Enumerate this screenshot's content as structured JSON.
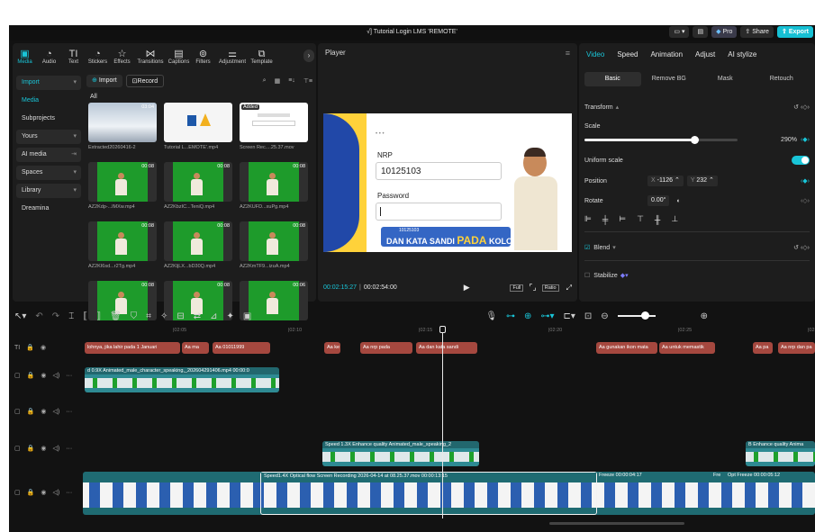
{
  "window": {
    "title": "√] Tutorial Login LMS 'REMOTE'",
    "pro_label": "Pro",
    "share_label": "Share",
    "export_label": "Export"
  },
  "media_toolbar": [
    {
      "label": "Media",
      "icon": "media-icon"
    },
    {
      "label": "Audio",
      "icon": "audio-icon"
    },
    {
      "label": "Text",
      "icon": "text-icon"
    },
    {
      "label": "Stickers",
      "icon": "sticker-icon"
    },
    {
      "label": "Effects",
      "icon": "effects-icon"
    },
    {
      "label": "Transitions",
      "icon": "transition-icon"
    },
    {
      "label": "Captions",
      "icon": "captions-icon"
    },
    {
      "label": "Filters",
      "icon": "filters-icon"
    },
    {
      "label": "Adjustment",
      "icon": "adjustment-icon"
    },
    {
      "label": "Template",
      "icon": "template-icon"
    }
  ],
  "sidebar": {
    "items": [
      {
        "label": "Import",
        "style": "dd-hl"
      },
      {
        "label": "Media",
        "style": "hl"
      },
      {
        "label": "Subprojects",
        "style": ""
      },
      {
        "label": "Yours",
        "style": "dd"
      },
      {
        "label": "AI media",
        "style": "dd"
      },
      {
        "label": "Spaces",
        "style": "dd"
      },
      {
        "label": "Library",
        "style": "dd"
      },
      {
        "label": "Dreamina",
        "style": ""
      }
    ]
  },
  "media": {
    "import_label": "Import",
    "record_label": "Record",
    "all_label": "All",
    "items": [
      {
        "caption": "Extracted20260416-2",
        "duration": "03:04",
        "kind": "screen",
        "added": false
      },
      {
        "caption": "Tutorial L...EMOTE'.mp4",
        "duration": "",
        "kind": "logo",
        "added": false
      },
      {
        "caption": "Screen Rec....25.37.mov",
        "duration": "",
        "kind": "screen2",
        "added": true
      },
      {
        "caption": "AZ2Kdp-...lMXw.mp4",
        "duration": "00:08",
        "kind": "green",
        "added": false
      },
      {
        "caption": "AZ2KbzIC...TeniQ.mp4",
        "duration": "00:08",
        "kind": "green",
        "added": false
      },
      {
        "caption": "AZ2KUFD...xuPg.mp4",
        "duration": "00:08",
        "kind": "green",
        "added": false
      },
      {
        "caption": "AZ2KI6sd...r2Tg.mp4",
        "duration": "00:08",
        "kind": "green",
        "added": false
      },
      {
        "caption": "AZ2KljLX...bD30Q.mp4",
        "duration": "00:08",
        "kind": "green",
        "added": false
      },
      {
        "caption": "AZ2KmTF9...izuA.mp4",
        "duration": "00:08",
        "kind": "green",
        "added": false
      },
      {
        "caption": "",
        "duration": "00:08",
        "kind": "green",
        "added": false
      },
      {
        "caption": "",
        "duration": "00:08",
        "kind": "green",
        "added": false
      },
      {
        "caption": "",
        "duration": "00:06",
        "kind": "green",
        "added": false
      }
    ],
    "added_label": "Added"
  },
  "player": {
    "title": "Player",
    "current_time": "00:02:15:27",
    "total_time": "00:02:54:00",
    "full_label": "Full",
    "ratio_label": "Ratio",
    "screen": {
      "nrp_label": "NRP",
      "nrp_value": "10125103",
      "password_label": "Password",
      "caption_small": "10125103",
      "caption_main": "DAN KATA SANDI",
      "caption_highlight": "PADA",
      "caption_end": "KOLOM"
    }
  },
  "inspector": {
    "tabs": [
      "Video",
      "Speed",
      "Animation",
      "Adjust",
      "AI stylize"
    ],
    "subtabs": [
      "Basic",
      "Remove BG",
      "Mask",
      "Retouch"
    ],
    "transform_label": "Transform",
    "scale_label": "Scale",
    "scale_value": "290%",
    "scale_level": 0.72,
    "uniform_scale_label": "Uniform scale",
    "position_label": "Position",
    "pos_x_label": "X",
    "pos_x": "-1126",
    "pos_y_label": "Y",
    "pos_y": "232",
    "rotate_label": "Rotate",
    "rotate_value": "0.00°",
    "blend_label": "Blend",
    "stabilize_label": "Stabilize"
  },
  "timeline": {
    "ruler": [
      "|02:05",
      "|02:10",
      "|02:15",
      "|02:20",
      "|02:25",
      "|02:30"
    ],
    "text_clips": [
      {
        "label": "lohnya, jika lahir pada 1 Januari"
      },
      {
        "label": "Aa ma"
      },
      {
        "label": "Aa 01011999"
      },
      {
        "label": "Aa ke"
      },
      {
        "label": "Aa nrp pada"
      },
      {
        "label": "Aa dan kata sandi"
      },
      {
        "label": "Aa gunakan ikon mata"
      },
      {
        "label": "Aa untuk memastik"
      },
      {
        "label": "Aa pa"
      },
      {
        "label": "Aa nrp dan pa"
      }
    ],
    "clip_a": "d 0.9X  Animated_male_character_speaking,_202604291406.mp4  00:00:0",
    "clip_b": "Speed 1.3X  Enhance quality  Animated_male_speaking_2",
    "clip_c": "B  Enhance quality  Anima",
    "main_clip": "Speed1.4X  Optical flow  Screen Recording 2026-04-14 at 08.25.37.mov  00:00:13:15",
    "freeze_a": "Freeze  00:00:04:17",
    "freeze_b_prefix": "Fre",
    "freeze_c": "Opt  Freeze  00:00:05:12"
  }
}
